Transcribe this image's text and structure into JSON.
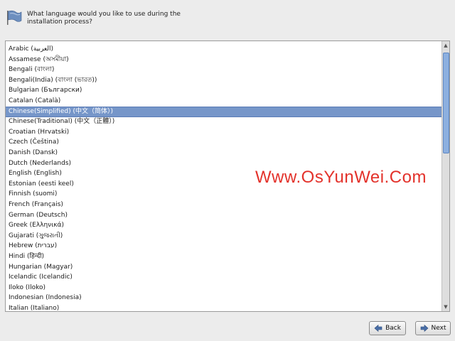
{
  "header": {
    "prompt": "What language would you like to use during the installation process?"
  },
  "languages": [
    {
      "label": "Arabic (العربية)",
      "selected": false
    },
    {
      "label": "Assamese (অসমীয়া)",
      "selected": false
    },
    {
      "label": "Bengali (বাংলা)",
      "selected": false
    },
    {
      "label": "Bengali(India) (বাংলা (ভারত))",
      "selected": false
    },
    {
      "label": "Bulgarian (Български)",
      "selected": false
    },
    {
      "label": "Catalan (Català)",
      "selected": false
    },
    {
      "label": "Chinese(Simplified) (中文（简体）)",
      "selected": true
    },
    {
      "label": "Chinese(Traditional) (中文（正體）)",
      "selected": false
    },
    {
      "label": "Croatian (Hrvatski)",
      "selected": false
    },
    {
      "label": "Czech (Čeština)",
      "selected": false
    },
    {
      "label": "Danish (Dansk)",
      "selected": false
    },
    {
      "label": "Dutch (Nederlands)",
      "selected": false
    },
    {
      "label": "English (English)",
      "selected": false
    },
    {
      "label": "Estonian (eesti keel)",
      "selected": false
    },
    {
      "label": "Finnish (suomi)",
      "selected": false
    },
    {
      "label": "French (Français)",
      "selected": false
    },
    {
      "label": "German (Deutsch)",
      "selected": false
    },
    {
      "label": "Greek (Ελληνικά)",
      "selected": false
    },
    {
      "label": "Gujarati (ગુજરાતી)",
      "selected": false
    },
    {
      "label": "Hebrew (עברית)",
      "selected": false
    },
    {
      "label": "Hindi (हिन्दी)",
      "selected": false
    },
    {
      "label": "Hungarian (Magyar)",
      "selected": false
    },
    {
      "label": "Icelandic (Icelandic)",
      "selected": false
    },
    {
      "label": "Iloko (Iloko)",
      "selected": false
    },
    {
      "label": "Indonesian (Indonesia)",
      "selected": false
    },
    {
      "label": "Italian (Italiano)",
      "selected": false
    }
  ],
  "watermark": "Www.OsYunWei.Com",
  "buttons": {
    "back_label": "Back",
    "next_label": "Next"
  },
  "colors": {
    "selection": "#7696c9",
    "watermark": "#e3322b"
  },
  "icons": {
    "header": "flag-icon",
    "back": "arrow-left-icon",
    "next": "arrow-right-icon"
  }
}
